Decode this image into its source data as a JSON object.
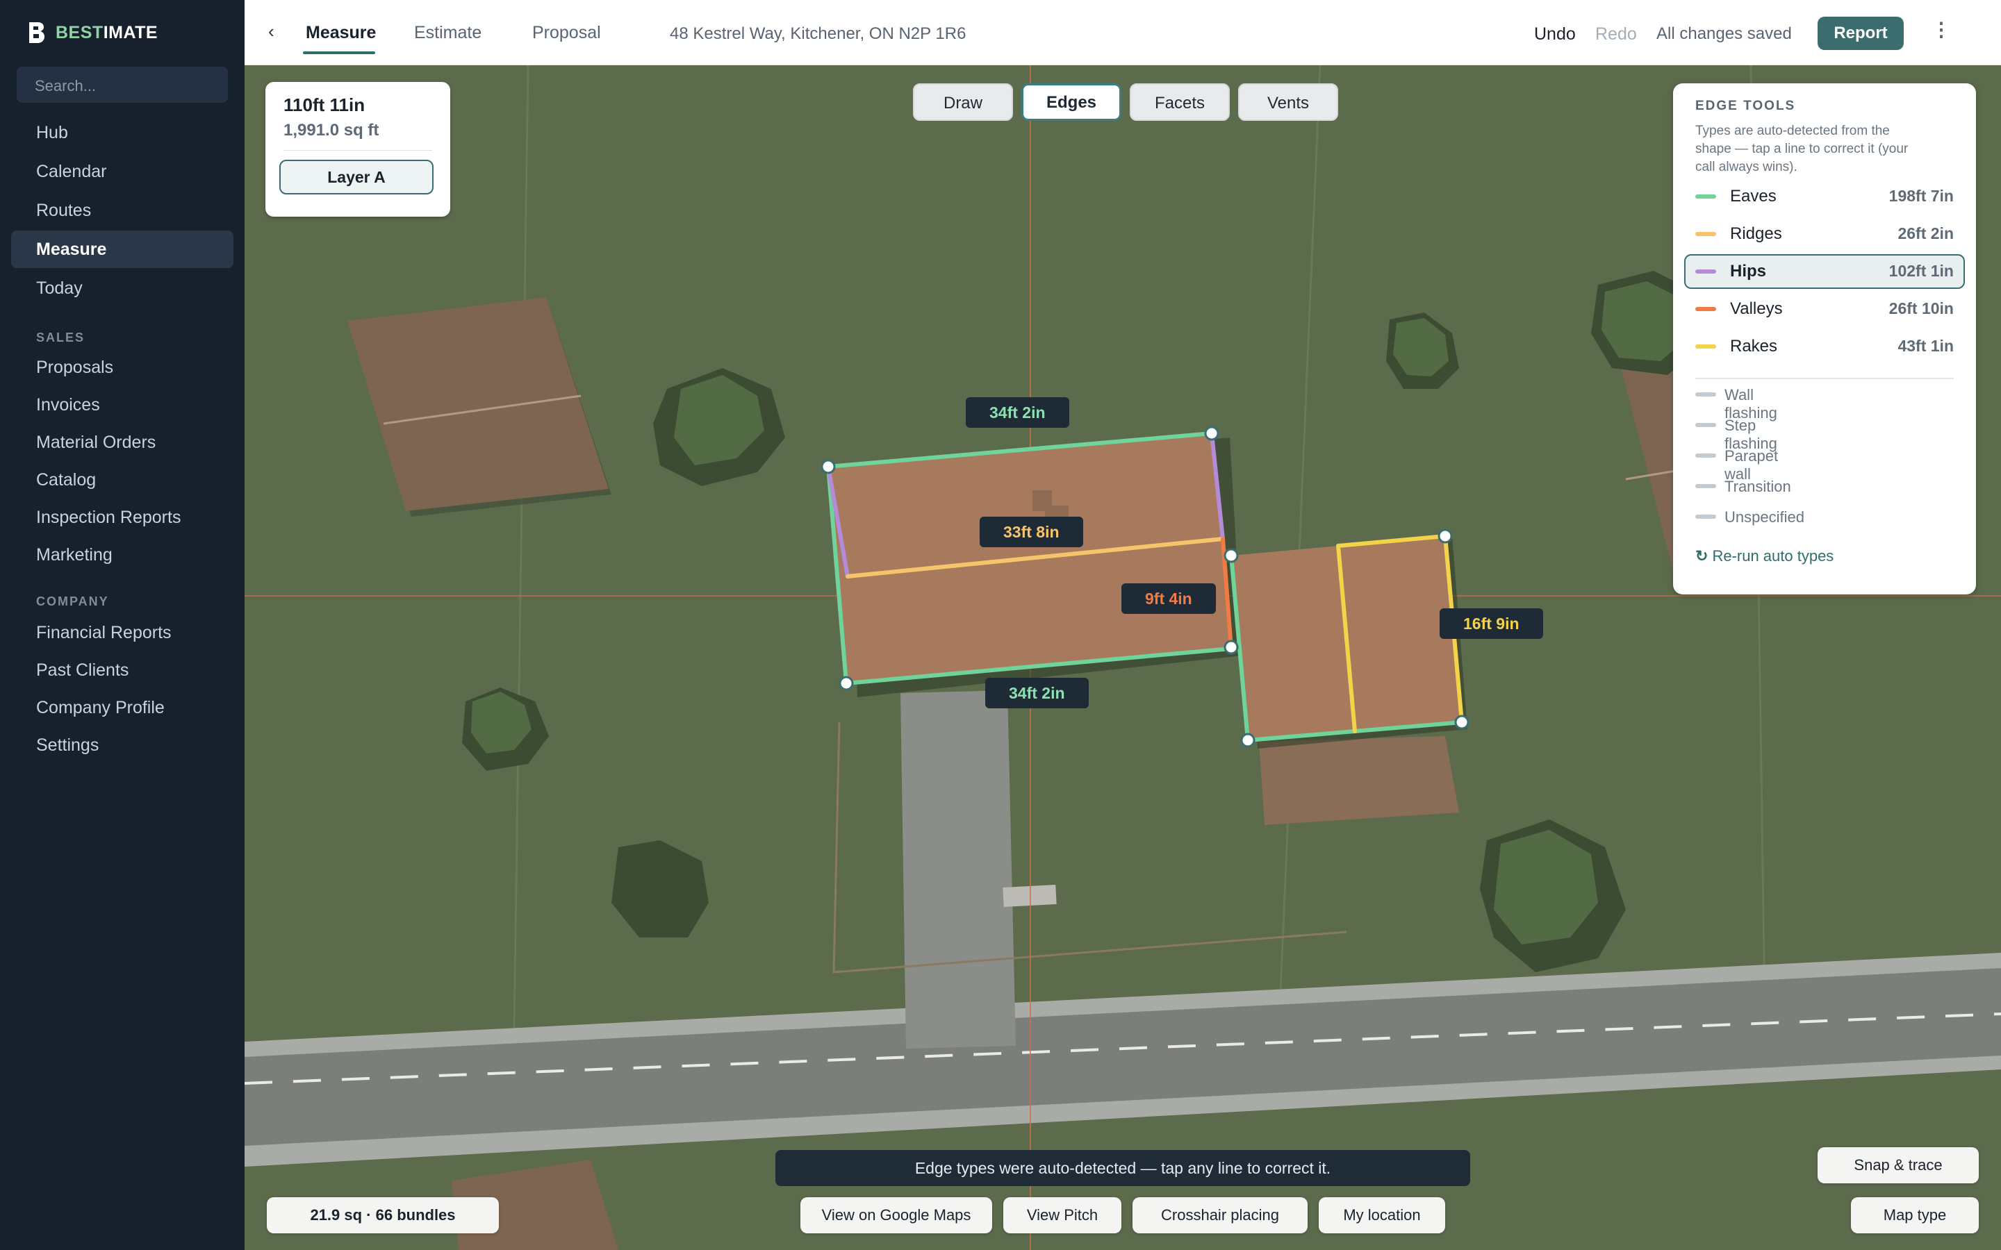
{
  "app": {
    "brand_prefix": "BEST",
    "brand_suffix": "IMATE"
  },
  "sidebar": {
    "search_placeholder": "Search...",
    "items_top": [
      {
        "label": "Hub"
      },
      {
        "label": "Calendar"
      },
      {
        "label": "Routes"
      },
      {
        "label": "Measure",
        "active": true
      },
      {
        "label": "Today"
      }
    ],
    "section_sales": "SALES",
    "items_sales": [
      {
        "label": "Proposals"
      },
      {
        "label": "Invoices"
      },
      {
        "label": "Material Orders"
      },
      {
        "label": "Catalog"
      },
      {
        "label": "Inspection Reports"
      },
      {
        "label": "Marketing"
      }
    ],
    "section_company": "COMPANY",
    "items_company": [
      {
        "label": "Financial Reports"
      },
      {
        "label": "Past Clients"
      },
      {
        "label": "Company Profile"
      },
      {
        "label": "Settings"
      }
    ]
  },
  "topbar": {
    "back_icon": "chevron-left-icon",
    "tabs": [
      {
        "label": "Measure",
        "active": true
      },
      {
        "label": "Estimate"
      },
      {
        "label": "Proposal"
      }
    ],
    "address": "48 Kestrel Way, Kitchener, ON N2P 1R6",
    "undo": "Undo",
    "redo": "Redo",
    "saved_status": "All changes saved",
    "report_button": "Report",
    "more_icon": "more-vertical-icon"
  },
  "mode_tabs": [
    {
      "label": "Draw"
    },
    {
      "label": "Edges",
      "active": true
    },
    {
      "label": "Facets"
    },
    {
      "label": "Vents"
    }
  ],
  "measure_card": {
    "length": "110ft 11in",
    "area": "1,991.0 sq ft",
    "layer_button": "Layer A"
  },
  "edge_tools": {
    "title": "EDGE TOOLS",
    "description": "Types are auto-detected from the shape — tap a line to correct it (your call always wins).",
    "types": [
      {
        "label": "Eaves",
        "value": "198ft 7in",
        "color": "#6fd39a"
      },
      {
        "label": "Ridges",
        "value": "26ft 2in",
        "color": "#f6c46a"
      },
      {
        "label": "Hips",
        "value": "102ft 1in",
        "color": "#b58ad8",
        "active": true
      },
      {
        "label": "Valleys",
        "value": "26ft 10in",
        "color": "#f07b45"
      },
      {
        "label": "Rakes",
        "value": "43ft 1in",
        "color": "#f3d34a"
      }
    ],
    "other_types": [
      {
        "label": "Wall flashing"
      },
      {
        "label": "Step flashing"
      },
      {
        "label": "Parapet wall"
      },
      {
        "label": "Transition"
      },
      {
        "label": "Unspecified"
      }
    ],
    "rerun_label": "Re-run auto types",
    "rerun_icon": "refresh-icon"
  },
  "map_labels": {
    "top_eave": "34ft 2in",
    "ridge": "33ft 8in",
    "valley": "9ft 4in",
    "rake": "16ft 9in",
    "bottom_eave": "34ft 2in"
  },
  "colors": {
    "eave": "#6fd39a",
    "ridge": "#f6c46a",
    "hip": "#b58ad8",
    "valley": "#f07b45",
    "rake": "#f3d34a",
    "accent": "#3b6c6e"
  },
  "bottom": {
    "toast": "Edge types were auto-detected — tap any line to correct it.",
    "summary": "21.9 sq · 66 bundles",
    "buttons": [
      {
        "label": "View on Google Maps"
      },
      {
        "label": "View Pitch"
      },
      {
        "label": "Crosshair placing"
      },
      {
        "label": "My location"
      }
    ],
    "snap_trace": "Snap & trace",
    "map_type": "Map type"
  }
}
